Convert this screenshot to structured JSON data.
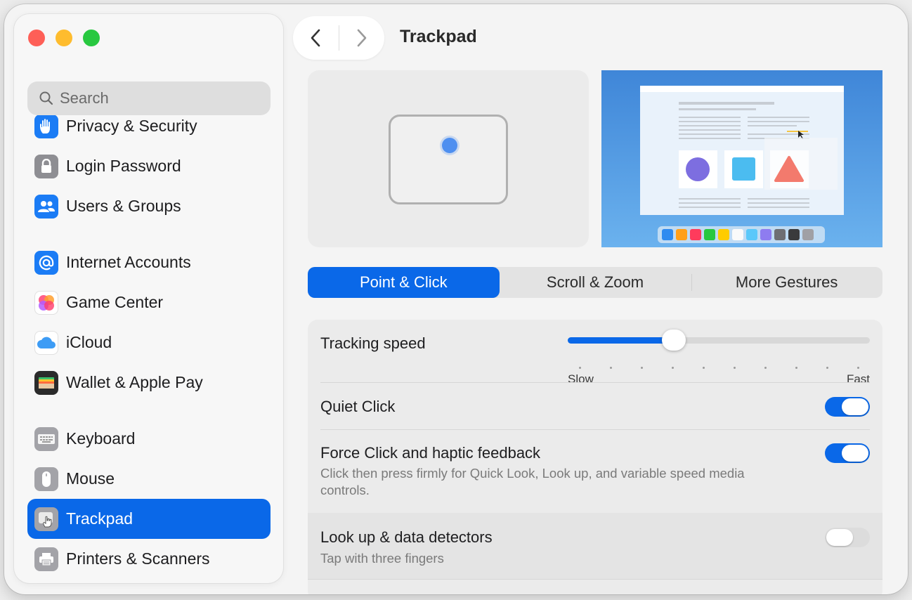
{
  "sidebar": {
    "search_placeholder": "Search",
    "items": [
      {
        "label": "Privacy & Security",
        "icon": "hand-icon",
        "color": "#1b7cf5"
      },
      {
        "label": "Login Password",
        "icon": "lock-icon",
        "color": "#8e8e93"
      },
      {
        "label": "Users & Groups",
        "icon": "users-icon",
        "color": "#1b7cf5"
      },
      {
        "label": "Internet Accounts",
        "icon": "at-icon",
        "color": "#1b7cf5"
      },
      {
        "label": "Game Center",
        "icon": "game-center-icon",
        "color": "#ff6b6b"
      },
      {
        "label": "iCloud",
        "icon": "cloud-icon",
        "color": "#4aa8ff"
      },
      {
        "label": "Wallet & Apple Pay",
        "icon": "wallet-icon",
        "color": "#2b2b2b"
      },
      {
        "label": "Keyboard",
        "icon": "keyboard-icon",
        "color": "#9a9a9a"
      },
      {
        "label": "Mouse",
        "icon": "mouse-icon",
        "color": "#9a9a9a"
      },
      {
        "label": "Trackpad",
        "icon": "trackpad-icon",
        "color": "#9a9a9a",
        "selected": true
      },
      {
        "label": "Printers & Scanners",
        "icon": "printer-icon",
        "color": "#9a9a9a"
      }
    ]
  },
  "header": {
    "title": "Trackpad"
  },
  "tabs": [
    {
      "label": "Point & Click",
      "active": true
    },
    {
      "label": "Scroll & Zoom",
      "active": false
    },
    {
      "label": "More Gestures",
      "active": false
    }
  ],
  "settings": {
    "tracking_speed": {
      "label": "Tracking speed",
      "min_label": "Slow",
      "max_label": "Fast",
      "value": 0.35
    },
    "quiet_click": {
      "label": "Quiet Click",
      "on": true
    },
    "force_click": {
      "label": "Force Click and haptic feedback",
      "description": "Click then press firmly for Quick Look, Look up, and variable speed media controls.",
      "on": true
    },
    "look_up": {
      "label": "Look up & data detectors",
      "description": "Tap with three fingers",
      "on": false
    }
  },
  "colors": {
    "accent": "#0a68e8"
  }
}
